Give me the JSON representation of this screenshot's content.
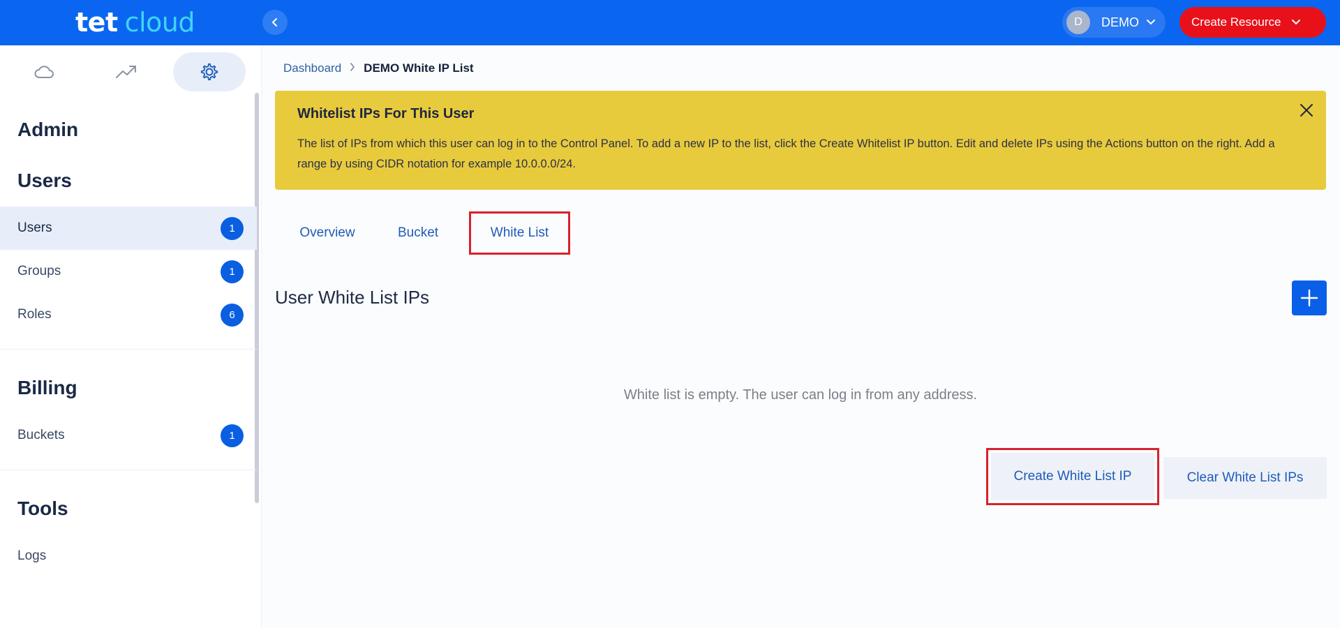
{
  "app": {
    "logo_part1": "tet",
    "logo_part2": "cloud",
    "collapse_icon": "chevron-left-icon"
  },
  "header": {
    "user_initial": "D",
    "user_name": "DEMO",
    "create_resource_label": "Create Resource"
  },
  "sidebar": {
    "top_tabs": [
      {
        "icon": "cloud-icon",
        "active": false
      },
      {
        "icon": "trending-up-icon",
        "active": false
      },
      {
        "icon": "gear-icon",
        "active": true
      }
    ],
    "admin_title": "Admin",
    "users_title": "Users",
    "users_items": [
      {
        "label": "Users",
        "count": "1",
        "active": true
      },
      {
        "label": "Groups",
        "count": "1",
        "active": false
      },
      {
        "label": "Roles",
        "count": "6",
        "active": false
      }
    ],
    "billing_title": "Billing",
    "billing_items": [
      {
        "label": "Buckets",
        "count": "1"
      }
    ],
    "tools_title": "Tools",
    "tools_items": [
      {
        "label": "Logs"
      }
    ]
  },
  "breadcrumb": {
    "root": "Dashboard",
    "current": "DEMO White IP List"
  },
  "alert": {
    "title": "Whitelist IPs For This User",
    "text": "The list of IPs from which this user can log in to the Control Panel. To add a new IP to the list, click the Create Whitelist IP button. Edit and delete IPs using the Actions button on the right. Add a range by using CIDR notation for example 10.0.0.0/24."
  },
  "tabs": [
    {
      "label": "Overview"
    },
    {
      "label": "Bucket"
    },
    {
      "label": "White List",
      "active": true
    }
  ],
  "section": {
    "title": "User White List IPs",
    "empty_message": "White list is empty. The user can log in from any address."
  },
  "actions": {
    "create_label": "Create White List IP",
    "clear_label": "Clear White List IPs"
  },
  "colors": {
    "primary": "#0a66f0",
    "danger": "#e8111a",
    "alert_bg": "#e8ca3d",
    "highlight": "#d9212c"
  }
}
